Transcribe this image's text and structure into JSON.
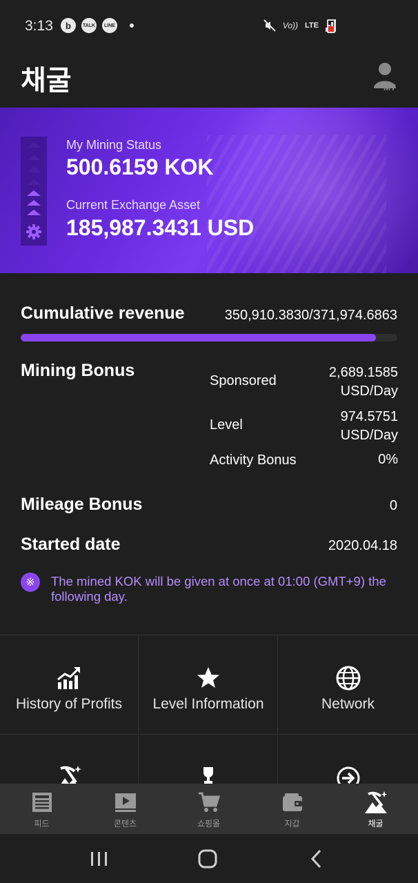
{
  "status_bar": {
    "time": "3:13",
    "app_icons": [
      "b",
      "TALK",
      "LINE"
    ],
    "network": "LTE",
    "carrier_text": "Vo))",
    "battery_color": "#e0302a"
  },
  "header": {
    "title": "채굴",
    "my_button_label": "MY"
  },
  "banner": {
    "mining_status_label": "My Mining Status",
    "mining_status_value": "500.6159 KOK",
    "exchange_label": "Current Exchange Asset",
    "exchange_value": "185,987.3431 USD",
    "accent_color": "#6a2be0"
  },
  "revenue": {
    "title": "Cumulative revenue",
    "value": "350,910.3830/371,974.6863",
    "progress_fraction": 0.9434
  },
  "mining_bonus": {
    "title": "Mining Bonus",
    "rows": [
      {
        "label": "Sponsored",
        "value_line1": "2,689.1585",
        "value_line2": "USD/Day"
      },
      {
        "label": "Level",
        "value_line1": "974.5751",
        "value_line2": "USD/Day"
      },
      {
        "label": "Activity Bonus",
        "value_line1": "0%",
        "value_line2": ""
      }
    ]
  },
  "mileage_bonus": {
    "title": "Mileage Bonus",
    "value": "0"
  },
  "started_date": {
    "title": "Started date",
    "value": "2020.04.18"
  },
  "notice": {
    "icon": "※",
    "text": "The mined KOK will be given at once  at 01:00 (GMT+9)  the following day."
  },
  "menu": {
    "items": [
      {
        "label": "History of Profits",
        "icon": "chart-up-icon"
      },
      {
        "label": "Level Information",
        "icon": "star-icon"
      },
      {
        "label": "Network",
        "icon": "globe-icon"
      },
      {
        "label": "",
        "icon": "pickaxe-icon"
      },
      {
        "label": "",
        "icon": "trophy-icon"
      },
      {
        "label": "",
        "icon": "arrow-circle-icon"
      }
    ]
  },
  "tabs": [
    {
      "label": "피드",
      "icon": "newspaper-icon"
    },
    {
      "label": "콘텐츠",
      "icon": "video-icon"
    },
    {
      "label": "쇼핑몰",
      "icon": "cart-icon"
    },
    {
      "label": "지갑",
      "icon": "wallet-icon"
    },
    {
      "label": "채굴",
      "icon": "pickaxe-icon",
      "active": true
    }
  ],
  "accent_color": "#8a45f0",
  "notice_color": "#b38dff"
}
